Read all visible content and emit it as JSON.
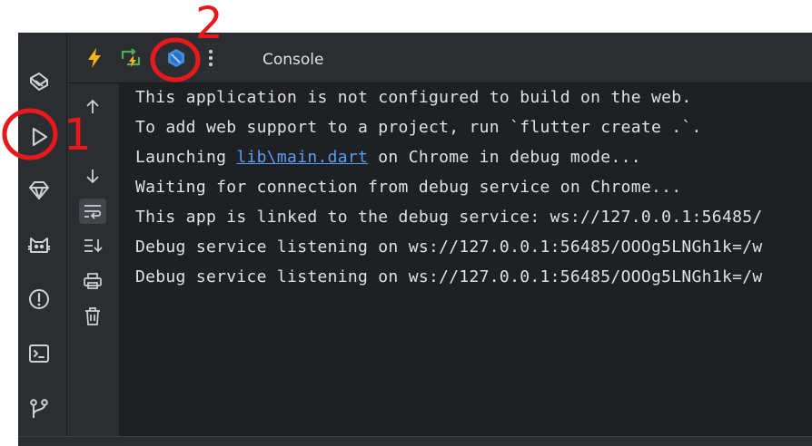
{
  "toolbar": {
    "tab_label": "Console",
    "icons": [
      "hot-reload-icon",
      "hot-restart-icon",
      "dart-devtools-icon",
      "more-options-icon"
    ]
  },
  "sidebar": {
    "icons": [
      "flutter-inspector-icon",
      "run-icon",
      "gem-icon",
      "cat-icon",
      "problems-icon",
      "terminal-icon",
      "git-icon"
    ]
  },
  "console": {
    "lines": [
      {
        "text": "This application is not configured to build on the web."
      },
      {
        "text": "To add web support to a project, run `flutter create .`."
      },
      {
        "prefix": "Launching ",
        "link": "lib\\main.dart",
        "suffix": " on Chrome in debug mode..."
      },
      {
        "text": "Waiting for connection from debug service on Chrome..."
      },
      {
        "text": "This app is linked to the debug service: ws://127.0.0.1:56485/"
      },
      {
        "text": "Debug service listening on ws://127.0.0.1:56485/OOOg5LNGh1k=/w"
      },
      {
        "text": "Debug service listening on ws://127.0.0.1:56485/OOOg5LNGh1k=/w"
      }
    ]
  },
  "annotations": {
    "label_1": "1",
    "label_2": "2",
    "color": "#e8191c"
  },
  "colors": {
    "background": "#1f2023",
    "panel": "#2b2d30",
    "text": "#dfe1e5",
    "link": "#589df6",
    "hot_reload": "#f5b31b",
    "hot_restart": "#4caf50"
  }
}
